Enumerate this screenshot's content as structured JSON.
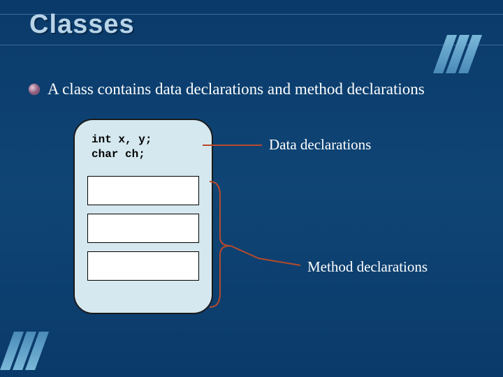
{
  "title": "Classes",
  "bullet": "A class contains data declarations and method declarations",
  "codeLine1": "int x, y;",
  "codeLine2": "char ch;",
  "labelData": "Data declarations",
  "labelMethods": "Method declarations",
  "colors": {
    "bg": "#0f4575",
    "boxFill": "#d5e8ef",
    "accent": "#b84a2a"
  }
}
